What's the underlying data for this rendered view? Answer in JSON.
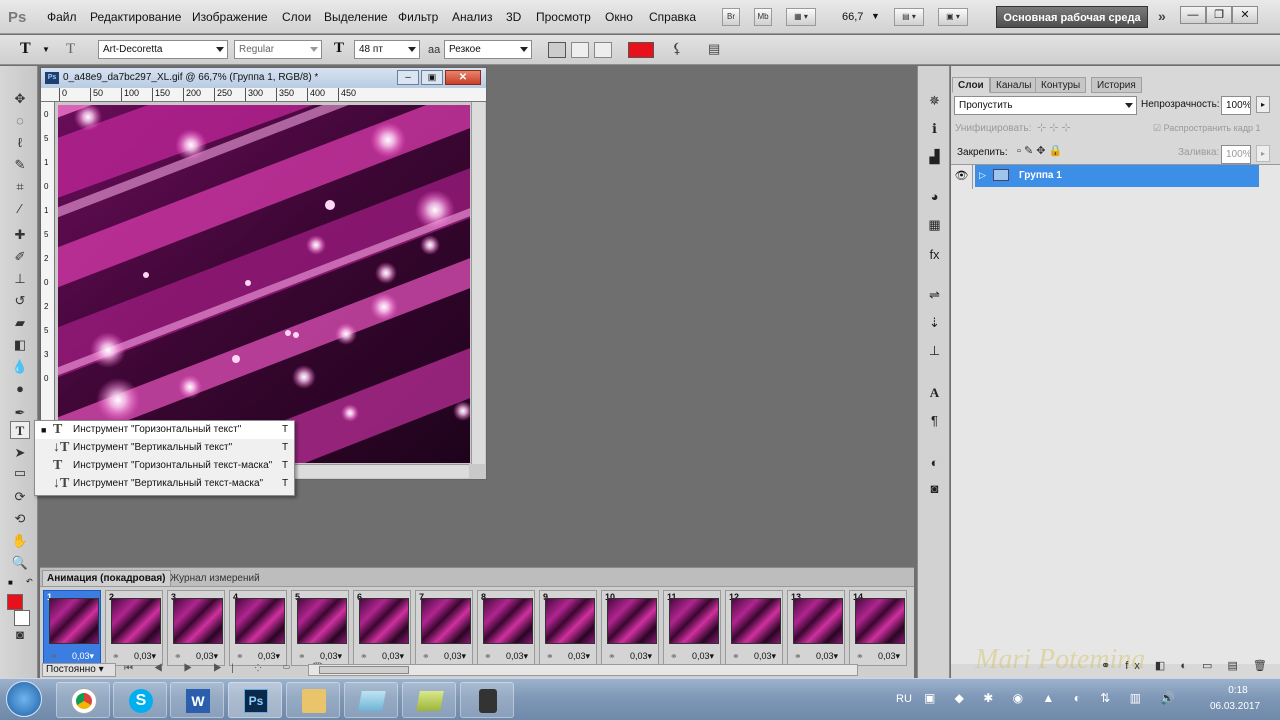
{
  "app": {
    "logo": "Ps"
  },
  "menu": [
    "Файл",
    "Редактирование",
    "Изображение",
    "Слои",
    "Выделение",
    "Фильтр",
    "Анализ",
    "3D",
    "Просмотр",
    "Окно",
    "Справка"
  ],
  "appbar": {
    "br": "Br",
    "mb": "Mb",
    "zoom": "66,7",
    "workspace": "Основная рабочая среда"
  },
  "options": {
    "font_family": "Art-Decoretta",
    "font_style": "Regular",
    "font_size": "48 пт",
    "aa_prefix": "aa",
    "antialias": "Резкое",
    "text_color": "#e8101a"
  },
  "document": {
    "title": "0_a48e9_da7bc297_XL.gif @ 66,7% (Группа 1, RGB/8) *",
    "ruler_ticks": [
      "0",
      "50",
      "100",
      "150",
      "200",
      "250",
      "300",
      "350",
      "400",
      "450"
    ],
    "ruler_vticks": [
      "0",
      "5",
      "1",
      "0",
      "1",
      "5",
      "2",
      "0",
      "2",
      "5",
      "3",
      "0"
    ]
  },
  "flyout": [
    {
      "label": "Инструмент \"Горизонтальный текст\"",
      "key": "T",
      "icon": "T",
      "active": true
    },
    {
      "label": "Инструмент \"Вертикальный текст\"",
      "key": "T",
      "icon": "↓T"
    },
    {
      "label": "Инструмент \"Горизонтальный текст-маска\"",
      "key": "T",
      "icon": "T"
    },
    {
      "label": "Инструмент \"Вертикальный текст-маска\"",
      "key": "T",
      "icon": "↓T"
    }
  ],
  "layers_panel": {
    "tabs": [
      "Слои",
      "Каналы",
      "Контуры",
      "История"
    ],
    "blend_mode": "Пропустить",
    "opacity_label": "Непрозрачность:",
    "opacity": "100%",
    "unify_label": "Унифицировать:",
    "propagate_label": "Распространить кадр 1",
    "lock_label": "Закрепить:",
    "fill_label": "Заливка:",
    "fill": "100%",
    "layers": [
      {
        "name": "Группа 1",
        "selected": true
      }
    ]
  },
  "animation_panel": {
    "tabs": [
      "Анимация (покадровая)",
      "Журнал измерений"
    ],
    "frames": [
      {
        "n": "1",
        "delay": "0,03"
      },
      {
        "n": "2",
        "delay": "0,03"
      },
      {
        "n": "3",
        "delay": "0,03"
      },
      {
        "n": "4",
        "delay": "0,03"
      },
      {
        "n": "5",
        "delay": "0,03"
      },
      {
        "n": "6",
        "delay": "0,03"
      },
      {
        "n": "7",
        "delay": "0,03"
      },
      {
        "n": "8",
        "delay": "0,03"
      },
      {
        "n": "9",
        "delay": "0,03"
      },
      {
        "n": "10",
        "delay": "0,03"
      },
      {
        "n": "11",
        "delay": "0,03"
      },
      {
        "n": "12",
        "delay": "0,03"
      },
      {
        "n": "13",
        "delay": "0,03"
      },
      {
        "n": "14",
        "delay": "0,03"
      }
    ],
    "loop": "Постоянно"
  },
  "taskbar": {
    "lang": "RU",
    "time": "0:18",
    "date": "06.03.2017",
    "watermark": "Mari Potemina"
  }
}
